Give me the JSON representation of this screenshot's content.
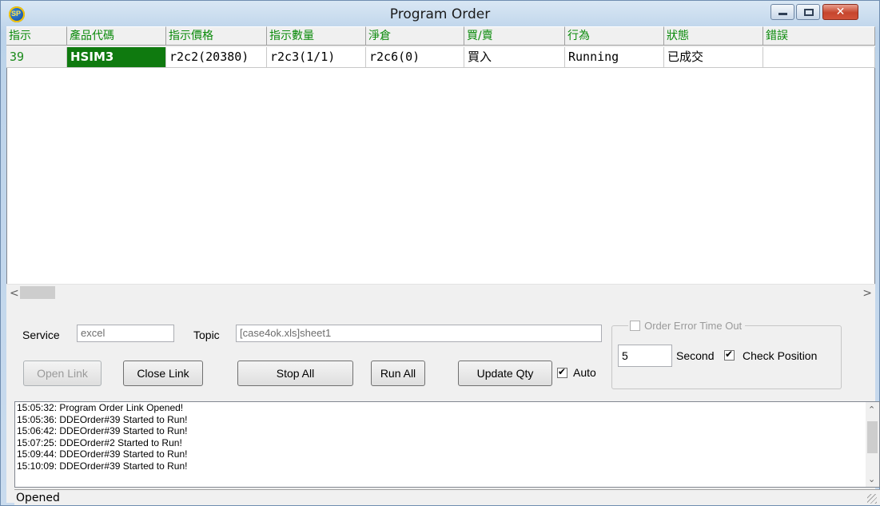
{
  "window": {
    "title": "Program Order",
    "icon": "app-logo-icon",
    "icon_text": "SP"
  },
  "grid": {
    "columns": [
      "指示",
      "產品代碼",
      "指示價格",
      "指示數量",
      "淨倉",
      "買/賣",
      "行為",
      "狀態",
      "錯誤"
    ],
    "rows": [
      [
        "39",
        "HSIM3",
        "r2c2(20380)",
        "r2c3(1/1)",
        "r2c6(0)",
        "買入",
        "Running",
        "已成交",
        ""
      ]
    ]
  },
  "link": {
    "service_label": "Service",
    "service_value": "excel",
    "topic_label": "Topic",
    "topic_value": "[case4ok.xls]sheet1"
  },
  "buttons": {
    "open_link": "Open Link",
    "close_link": "Close Link",
    "stop_all": "Stop All",
    "run_all": "Run All",
    "update_qty": "Update Qty"
  },
  "auto": {
    "label": "Auto",
    "checked": true
  },
  "error_timeout": {
    "label": "Order Error Time Out",
    "checked": false,
    "seconds_value": "5",
    "seconds_label": "Second",
    "check_position_label": "Check Position",
    "check_position_checked": true
  },
  "log": [
    "15:05:32: Program Order Link Opened!",
    "15:05:36: DDEOrder#39 Started to Run!",
    "15:06:42: DDEOrder#39 Started to Run!",
    "15:07:25: DDEOrder#2 Started to Run!",
    "15:09:44: DDEOrder#39 Started to Run!",
    "15:10:09: DDEOrder#39 Started to Run!"
  ],
  "status_text": "Opened"
}
